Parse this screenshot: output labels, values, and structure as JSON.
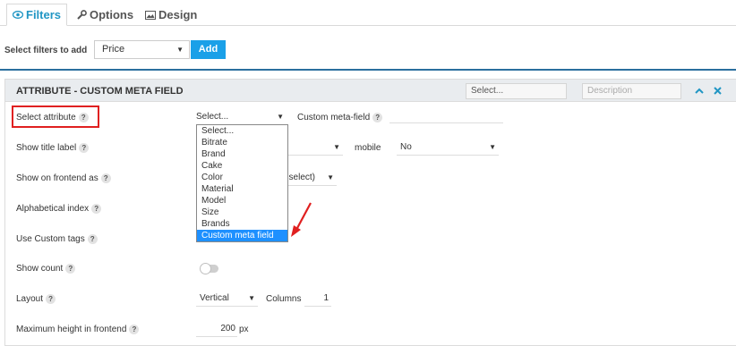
{
  "tabs": [
    {
      "label": "Filters",
      "icon": "eye-icon",
      "active": true
    },
    {
      "label": "Options",
      "icon": "wrench-icon",
      "active": false
    },
    {
      "label": "Design",
      "icon": "image-icon",
      "active": false
    }
  ],
  "add_filter": {
    "label": "Select filters to add",
    "selected": "Price",
    "button": "Add"
  },
  "panel": {
    "title": "ATTRIBUTE - CUSTOM META FIELD",
    "select_placeholder": "Select...",
    "description_placeholder": "Description"
  },
  "rows": {
    "select_attribute": {
      "label": "Select attribute",
      "value": "Select..."
    },
    "custom_meta_field": {
      "label": "Custom meta-field",
      "value": ""
    },
    "show_title_label": {
      "label": "Show title label"
    },
    "mobile": {
      "label": "mobile",
      "value": "No"
    },
    "show_on_frontend": {
      "label": "Show on frontend as",
      "value": "select)"
    },
    "alphabetical_index": {
      "label": "Alphabetical index"
    },
    "use_custom_tags": {
      "label": "Use Custom tags"
    },
    "show_count": {
      "label": "Show count"
    },
    "layout": {
      "label": "Layout",
      "value": "Vertical"
    },
    "columns": {
      "label": "Columns",
      "value": "1"
    },
    "max_height": {
      "label": "Maximum height in frontend",
      "value": "200",
      "unit": "px"
    }
  },
  "help_glyph": "?",
  "dropdown": {
    "options": [
      "Select...",
      "Bitrate",
      "Brand",
      "Cake",
      "Color",
      "Material",
      "Model",
      "Size",
      "Brands",
      "Custom meta field"
    ],
    "highlighted": "Custom meta field"
  },
  "colors": {
    "accent": "#1aa0e8",
    "annotation": "#e02020",
    "highlight": "#1e90ff"
  }
}
